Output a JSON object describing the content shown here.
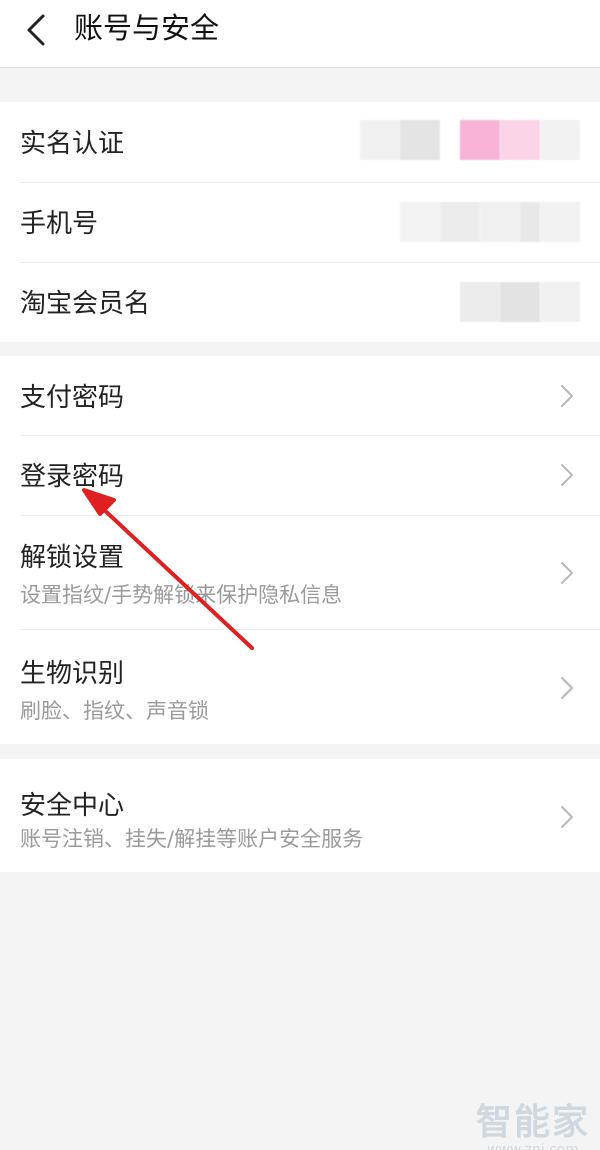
{
  "header": {
    "title": "账号与安全",
    "back_icon": "chevron-left-icon"
  },
  "group1": {
    "real_name": {
      "label": "实名认证"
    },
    "phone": {
      "label": "手机号"
    },
    "taobao": {
      "label": "淘宝会员名"
    }
  },
  "group2": {
    "pay_password": {
      "label": "支付密码"
    },
    "login_password": {
      "label": "登录密码"
    },
    "unlock": {
      "label": "解锁设置",
      "sub": "设置指纹/手势解锁来保护隐私信息"
    },
    "biometric": {
      "label": "生物识别",
      "sub": "刷脸、指纹、声音锁"
    }
  },
  "group3": {
    "security_center": {
      "label": "安全中心",
      "sub": "账号注销、挂失/解挂等账户安全服务"
    }
  },
  "annotation": {
    "arrow_color": "#e02020"
  },
  "watermark": {
    "brand": "智能家",
    "url": "www.znj.com"
  },
  "colors": {
    "background": "#f4f4f4",
    "card": "#ffffff",
    "subtext": "#9a9a9a"
  }
}
